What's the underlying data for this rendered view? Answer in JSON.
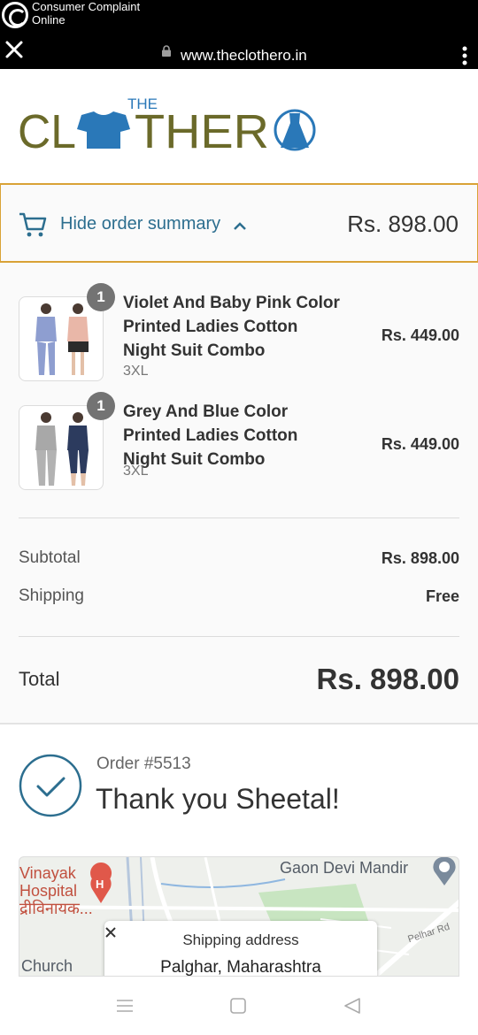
{
  "status_bar": {
    "app_title": "Consumer Complaint Online"
  },
  "browser": {
    "url": "www.theclothero.in"
  },
  "logo": {
    "small": "THE",
    "text_left": "CL",
    "text_mid": "THER"
  },
  "summary": {
    "toggle_label": "Hide order summary",
    "header_total": "Rs. 898.00",
    "items": [
      {
        "quantity": "1",
        "name": "Violet And Baby Pink Color Printed Ladies Cotton Night Suit Combo",
        "variant": "3XL",
        "price": "Rs. 449.00"
      },
      {
        "quantity": "1",
        "name": "Grey And Blue Color Printed Ladies Cotton Night Suit Combo",
        "variant": "3XL",
        "price": "Rs. 449.00"
      }
    ],
    "subtotal_label": "Subtotal",
    "subtotal_value": "Rs. 898.00",
    "shipping_label": "Shipping",
    "shipping_value": "Free",
    "total_label": "Total",
    "total_value": "Rs. 898.00"
  },
  "confirmation": {
    "order_number": "Order #5513",
    "thank_you": "Thank you Sheetal!"
  },
  "map": {
    "place_1": "Vinayak\nHospital\nद्रीविनायक...",
    "place_2": "Gaon Devi Mandir",
    "place_3": "Church",
    "road": "Pelhar Rd",
    "card_label": "Shipping address",
    "card_city": "Palghar, Maharashtra"
  },
  "colors": {
    "accent_link": "#2c6e8f",
    "logo_olive": "#6b6a2a",
    "logo_blue": "#2a78b8",
    "toggle_border": "#d9a236"
  }
}
